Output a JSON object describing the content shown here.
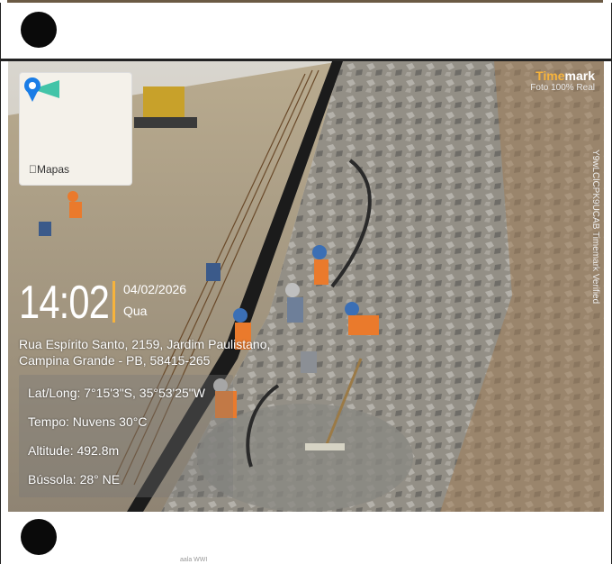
{
  "feed": {
    "posts": [
      {
        "avatar": "avatar"
      },
      {
        "photo_overlay": {
          "map_label": "Mapas",
          "brand_first": "Time",
          "brand_second": "mark",
          "brand_sub": "Foto 100% Real",
          "vertical_label": "Y9wLClCPK9UCAB Timemark Verified",
          "time": "14:02",
          "date": "04/02/2026",
          "day_of_week": "Qua",
          "address_line1": "Rua Espírito Santo, 2159, Jardim Paulistano,",
          "address_line2": "Campina Grande - PB, 58415-265",
          "latlong": "Lat/Long: 7°15'3\"S, 35°53'25\"W",
          "tempo": "Tempo: Nuvens 30°C",
          "altitude": "Altitude: 492.8m",
          "bussola": "Bússola: 28° NE"
        }
      },
      {
        "avatar": "avatar"
      }
    ],
    "faint_text": "aala WWI"
  },
  "colors": {
    "accent": "#f6b33c",
    "avatar": "#0a0a0a",
    "border": "#222222"
  }
}
